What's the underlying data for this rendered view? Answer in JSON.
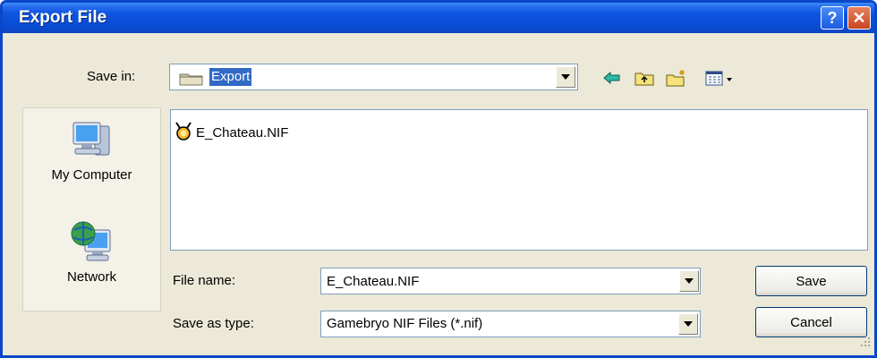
{
  "window": {
    "title": "Export File"
  },
  "titlebar": {
    "help_label": "?",
    "close_label": "✕"
  },
  "save_in": {
    "label": "Save in:",
    "value": "Export"
  },
  "toolbar": [
    "back-icon",
    "up-folder-icon",
    "new-folder-icon",
    "view-menu-icon"
  ],
  "places": [
    {
      "label": "My Computer",
      "icon": "my-computer-icon"
    },
    {
      "label": "Network",
      "icon": "network-icon"
    }
  ],
  "files": [
    {
      "name": "E_Chateau.NIF",
      "icon": "nif-file-icon"
    }
  ],
  "file_name": {
    "label": "File name:",
    "value": "E_Chateau.NIF"
  },
  "save_type": {
    "label": "Save as type:",
    "value": "Gamebryo NIF Files (*.nif)"
  },
  "buttons": {
    "save": "Save",
    "cancel": "Cancel"
  },
  "colors": {
    "titlebar": "#0a4dd6",
    "selection": "#316ac5",
    "dialog_bg": "#ece9d8"
  }
}
